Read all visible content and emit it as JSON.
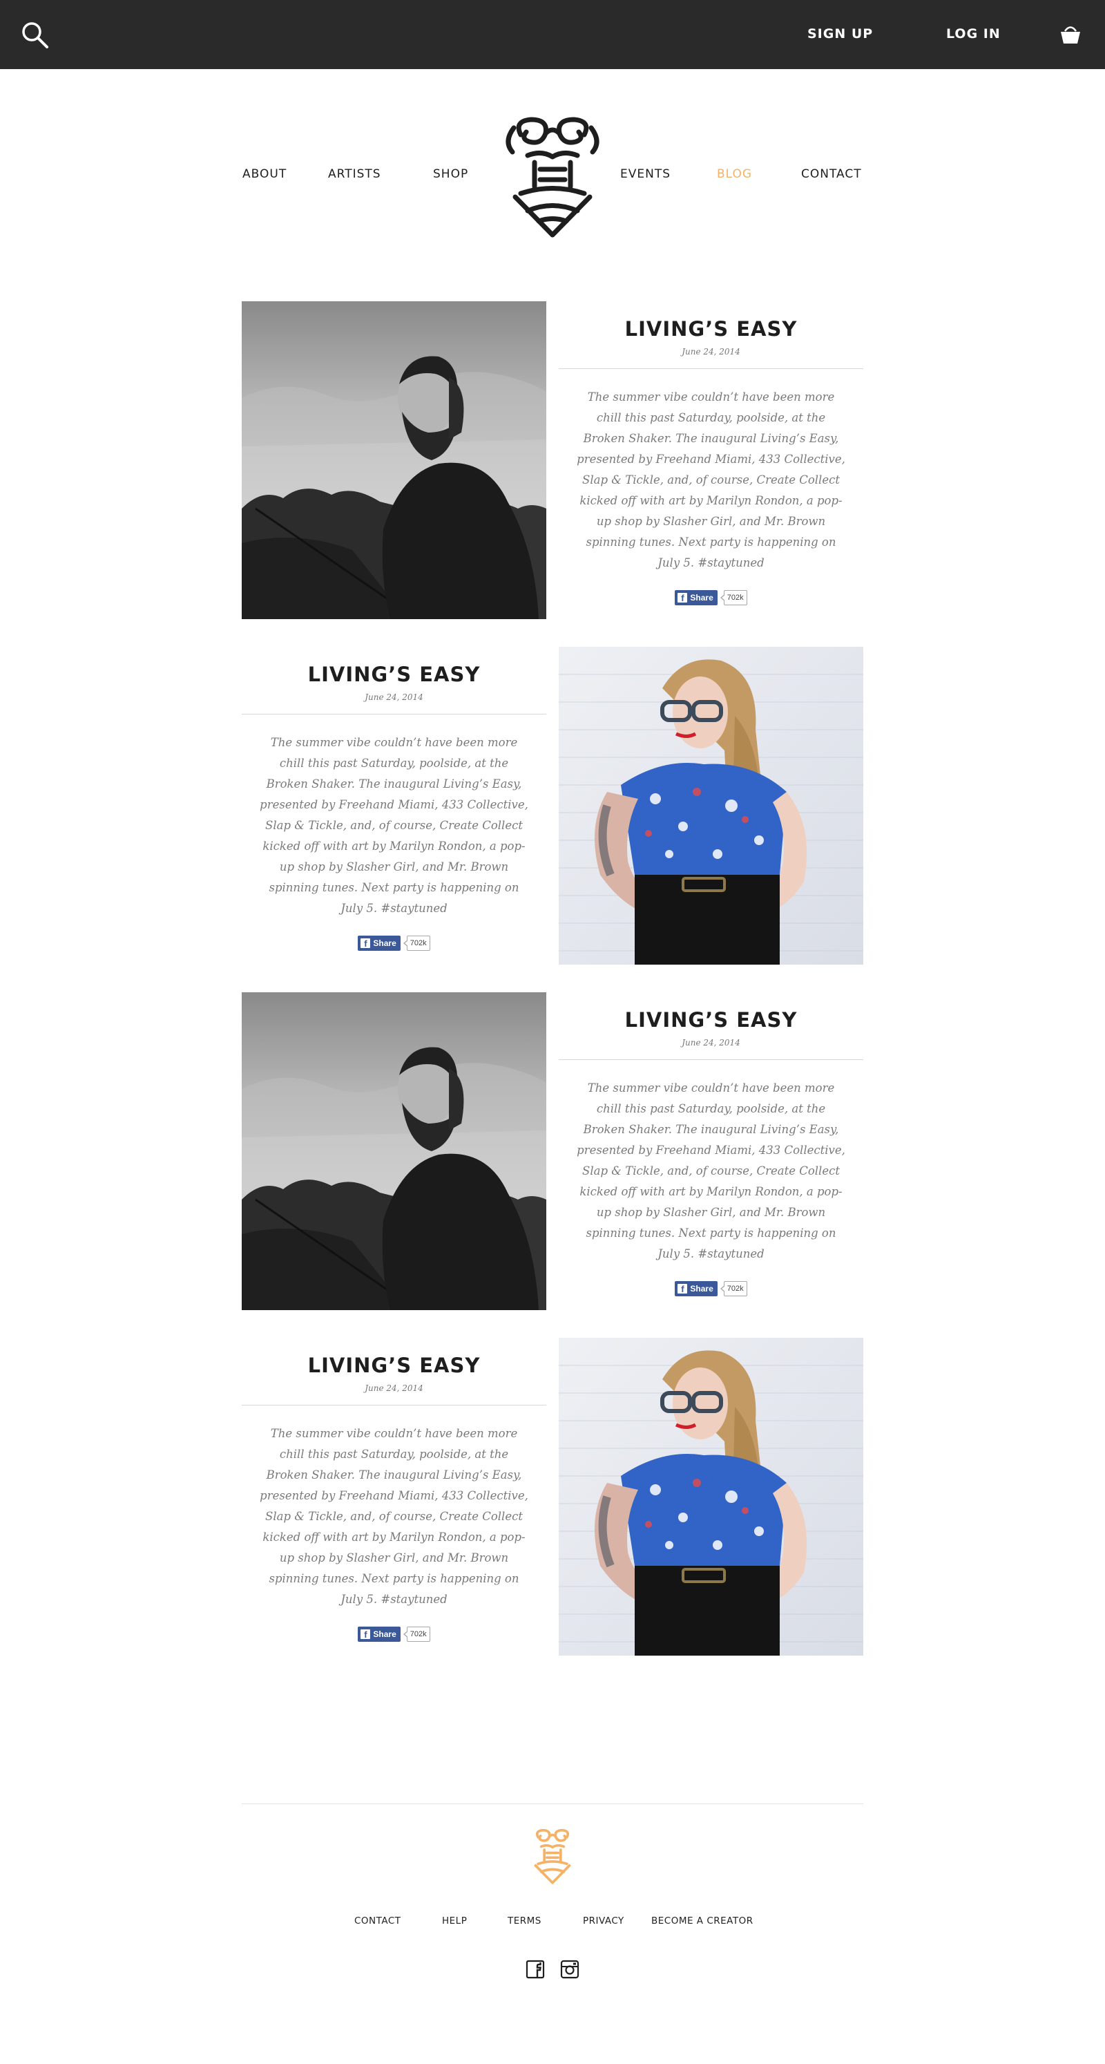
{
  "topbar": {
    "search_icon": "search-icon",
    "signup_label": "SIGN UP",
    "login_label": "LOG IN",
    "basket_icon": "basket-icon"
  },
  "nav": {
    "items": [
      {
        "label": "ABOUT"
      },
      {
        "label": "ARTISTS"
      },
      {
        "label": "SHOP"
      },
      {
        "label": "EVENTS"
      },
      {
        "label": "BLOG",
        "active": true
      },
      {
        "label": "CONTACT"
      }
    ],
    "active_color": "#f5b266"
  },
  "posts": [
    {
      "title": "LIVING’S EASY",
      "date": "June 24, 2014",
      "body": "The summer vibe couldn’t have been more chill this past Saturday, poolside, at the Broken Shaker. The inaugural Living’s Easy, presented by Freehand Miami, 433 Collective, Slap & Tickle, and, of course, Create Collect kicked off with art by Marilyn Rondon, a pop-up shop by Slasher Girl, and Mr. Brown spinning tunes. Next party is happening on July 5. #staytuned",
      "share_label": "Share",
      "share_count": "702k",
      "photo": "bearded-man-photo"
    },
    {
      "title": "LIVING’S EASY",
      "date": "June 24, 2014",
      "body": "The summer vibe couldn’t have been more chill this past Saturday, poolside, at the Broken Shaker. The inaugural Living’s Easy, presented by Freehand Miami, 433 Collective, Slap & Tickle, and, of course, Create Collect kicked off with art by Marilyn Rondon, a pop-up shop by Slasher Girl, and Mr. Brown spinning tunes. Next party is happening on July 5. #staytuned",
      "share_label": "Share",
      "share_count": "702k",
      "photo": "woman-glasses-photo"
    },
    {
      "title": "LIVING’S EASY",
      "date": "June 24, 2014",
      "body": "The summer vibe couldn’t have been more chill this past Saturday, poolside, at the Broken Shaker. The inaugural Living’s Easy, presented by Freehand Miami, 433 Collective, Slap & Tickle, and, of course, Create Collect kicked off with art by Marilyn Rondon, a pop-up shop by Slasher Girl, and Mr. Brown spinning tunes. Next party is happening on July 5. #staytuned",
      "share_label": "Share",
      "share_count": "702k",
      "photo": "bearded-man-photo"
    },
    {
      "title": "LIVING’S EASY",
      "date": "June 24, 2014",
      "body": "The summer vibe couldn’t have been more chill this past Saturday, poolside, at the Broken Shaker. The inaugural Living’s Easy, presented by Freehand Miami, 433 Collective, Slap & Tickle, and, of course, Create Collect kicked off with art by Marilyn Rondon, a pop-up shop by Slasher Girl, and Mr. Brown spinning tunes. Next party is happening on July 5. #staytuned",
      "share_label": "Share",
      "share_count": "702k",
      "photo": "woman-glasses-photo"
    }
  ],
  "footer": {
    "links": [
      {
        "label": "CONTACT"
      },
      {
        "label": "HELP"
      },
      {
        "label": "TERMS"
      },
      {
        "label": "PRIVACY"
      },
      {
        "label": "BECOME A CREATOR"
      }
    ],
    "social": [
      "facebook-icon",
      "instagram-icon"
    ],
    "logo_color": "#f5b266"
  }
}
